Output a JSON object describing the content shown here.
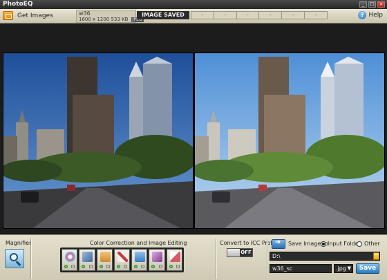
{
  "app": {
    "title": "PhotoEQ"
  },
  "window_controls": [
    "_",
    "□",
    "×"
  ],
  "toolbar": {
    "get_images_label": "Get Images",
    "file_name": "w36",
    "file_dimensions": "1600 x 1200",
    "file_size": "533 KB",
    "file_format": "JPEG",
    "status": "IMAGE SAVED",
    "progress_segments": [
      "-",
      "-",
      "-",
      "-",
      "-",
      "-"
    ],
    "help_label": "Help"
  },
  "bottom": {
    "magnifier_label": "Magnifier",
    "color_correction_label": "Color Correction and Image Editing",
    "tools": [
      {
        "name": "color-balance",
        "color": "#e65f9b"
      },
      {
        "name": "brightness",
        "color": "#6a8fb8"
      },
      {
        "name": "levels",
        "color": "#d08a2c"
      },
      {
        "name": "resize",
        "color": "#c43a3a"
      },
      {
        "name": "crop",
        "color": "#3b7cc4"
      },
      {
        "name": "sharpen",
        "color": "#b65cb9"
      },
      {
        "name": "eraser",
        "color": "#d55a6a"
      }
    ],
    "icc_label": "Convert to ICC Profile",
    "icc_state": "OFF",
    "save_image_to_label": "Save Image to",
    "input_folder_label": "Input Folder",
    "other_label": "Other",
    "output_path": "D:\\",
    "output_name": "w36_sc",
    "output_format": ".jpg",
    "save_label": "Save"
  },
  "colors": {
    "toolbar_bg": "#d6d1bc",
    "status_bg": "#2b2b2b",
    "accent_blue": "#2b79c0"
  }
}
